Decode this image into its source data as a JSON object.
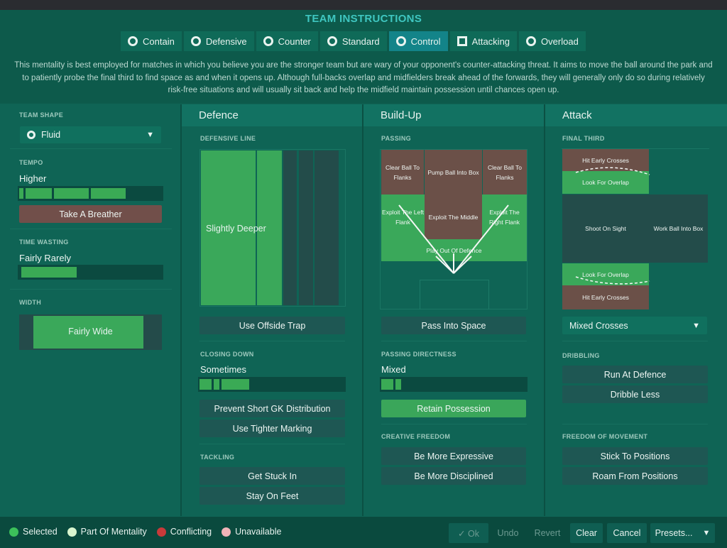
{
  "title": "TEAM INSTRUCTIONS",
  "tabs": [
    {
      "label": "Contain"
    },
    {
      "label": "Defensive"
    },
    {
      "label": "Counter"
    },
    {
      "label": "Standard"
    },
    {
      "label": "Control",
      "active": true
    },
    {
      "label": "Attacking"
    },
    {
      "label": "Overload"
    }
  ],
  "description": "This mentality is best employed for matches in which you believe you are the stronger team but are wary of your opponent's counter-attacking threat. It aims to move the ball around the park and to patiently probe the final third to find space as and when it opens up. Although full-backs overlap and midfielders break ahead of the forwards, they will generally only do so during relatively risk-free situations and will usually sit back and help the midfield maintain possession until chances open up.",
  "left": {
    "team_shape_label": "TEAM SHAPE",
    "team_shape": "Fluid",
    "tempo_label": "TEMPO",
    "tempo": "Higher",
    "tempo_level": 0.75,
    "tempo_button": "Take A Breather",
    "time_wasting_label": "TIME WASTING",
    "time_wasting": "Fairly Rarely",
    "time_wasting_level": 0.38,
    "width_label": "WIDTH",
    "width": "Fairly Wide"
  },
  "defence": {
    "heading": "Defence",
    "line_label": "DEFENSIVE LINE",
    "line": "Slightly Deeper",
    "offside": "Use Offside Trap",
    "closing_label": "CLOSING DOWN",
    "closing": "Sometimes",
    "closing_level": 0.34,
    "gk": "Prevent Short GK Distribution",
    "marking": "Use Tighter Marking",
    "tackling_label": "TACKLING",
    "stuck_in": "Get Stuck In",
    "stay_feet": "Stay On Feet"
  },
  "buildup": {
    "heading": "Build-Up",
    "passing_label": "PASSING",
    "clear_left": "Clear Ball To Flanks",
    "pump": "Pump Ball Into Box",
    "clear_right": "Clear Ball To Flanks",
    "exploit_left": "Exploit The Left Flank",
    "exploit_middle": "Exploit The Middle",
    "exploit_right": "Exploit The Right Flank",
    "play_out": "Play Out Of Defence",
    "pass_space": "Pass Into Space",
    "directness_label": "PASSING DIRECTNESS",
    "directness": "Mixed",
    "directness_level": 0.14,
    "retain": "Retain Possession",
    "creative_label": "CREATIVE FREEDOM",
    "expressive": "Be More Expressive",
    "disciplined": "Be More Disciplined"
  },
  "attack": {
    "heading": "Attack",
    "final_third_label": "FINAL THIRD",
    "early_top": "Hit Early Crosses",
    "overlap_top": "Look For Overlap",
    "shoot": "Shoot On Sight",
    "work_box": "Work Ball Into Box",
    "overlap_bottom": "Look For Overlap",
    "early_bottom": "Hit Early Crosses",
    "crosses": "Mixed Crosses",
    "dribbling_label": "DRIBBLING",
    "run_defence": "Run At Defence",
    "dribble_less": "Dribble Less",
    "freedom_label": "FREEDOM OF MOVEMENT",
    "stick": "Stick To Positions",
    "roam": "Roam From Positions"
  },
  "legend": [
    {
      "label": "Selected",
      "color": "#3cc05a"
    },
    {
      "label": "Part Of Mentality",
      "color": "#d8f5cf"
    },
    {
      "label": "Conflicting",
      "color": "#c83a3a"
    },
    {
      "label": "Unavailable",
      "color": "#f0b4b8"
    }
  ],
  "footer": {
    "ok": "✓ Ok",
    "undo": "Undo",
    "revert": "Revert",
    "clear": "Clear",
    "cancel": "Cancel",
    "presets": "Presets..."
  }
}
